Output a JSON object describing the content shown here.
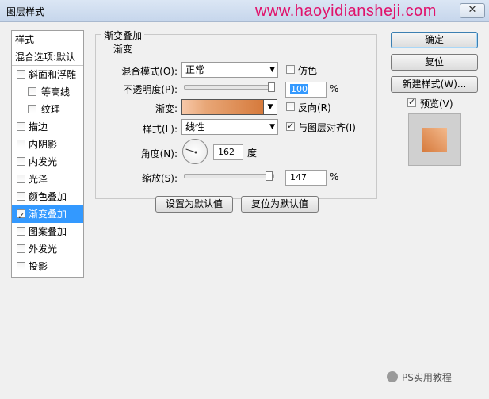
{
  "window": {
    "title": "图层样式",
    "close_glyph": "✕",
    "watermark": "www.haoyidiansheji.com"
  },
  "left_list": {
    "header": "样式",
    "subheader": "混合选项:默认",
    "items": [
      {
        "label": "斜面和浮雕",
        "checked": false,
        "indent": false,
        "selected": false
      },
      {
        "label": "等高线",
        "checked": false,
        "indent": true,
        "selected": false
      },
      {
        "label": "纹理",
        "checked": false,
        "indent": true,
        "selected": false
      },
      {
        "label": "描边",
        "checked": false,
        "indent": false,
        "selected": false
      },
      {
        "label": "内阴影",
        "checked": false,
        "indent": false,
        "selected": false
      },
      {
        "label": "内发光",
        "checked": false,
        "indent": false,
        "selected": false
      },
      {
        "label": "光泽",
        "checked": false,
        "indent": false,
        "selected": false
      },
      {
        "label": "颜色叠加",
        "checked": false,
        "indent": false,
        "selected": false
      },
      {
        "label": "渐变叠加",
        "checked": true,
        "indent": false,
        "selected": true
      },
      {
        "label": "图案叠加",
        "checked": false,
        "indent": false,
        "selected": false
      },
      {
        "label": "外发光",
        "checked": false,
        "indent": false,
        "selected": false
      },
      {
        "label": "投影",
        "checked": false,
        "indent": false,
        "selected": false
      }
    ]
  },
  "panel": {
    "group_title": "渐变叠加",
    "sub_title": "渐变",
    "blend_mode": {
      "label": "混合模式(O):",
      "value": "正常"
    },
    "dither": {
      "label": "仿色",
      "checked": false
    },
    "opacity": {
      "label": "不透明度(P):",
      "value": "100",
      "unit": "%",
      "level": 100
    },
    "gradient": {
      "label": "渐变:",
      "colors": [
        "#f7c8a8",
        "#e8a676",
        "#d67a3c"
      ]
    },
    "reverse": {
      "label": "反向(R)",
      "checked": false
    },
    "style": {
      "label": "样式(L):",
      "value": "线性"
    },
    "align": {
      "label": "与图层对齐(I)",
      "checked": true
    },
    "angle": {
      "label": "角度(N):",
      "value": "162",
      "unit": "度",
      "degrees": 162
    },
    "scale": {
      "label": "缩放(S):",
      "value": "147",
      "unit": "%",
      "level": 147
    },
    "set_default": "设置为默认值",
    "reset_default": "复位为默认值"
  },
  "right": {
    "ok": "确定",
    "reset": "复位",
    "new_style": "新建样式(W)...",
    "preview": {
      "label": "预览(V)",
      "checked": true
    }
  },
  "footer": {
    "brand": "PS实用教程"
  }
}
